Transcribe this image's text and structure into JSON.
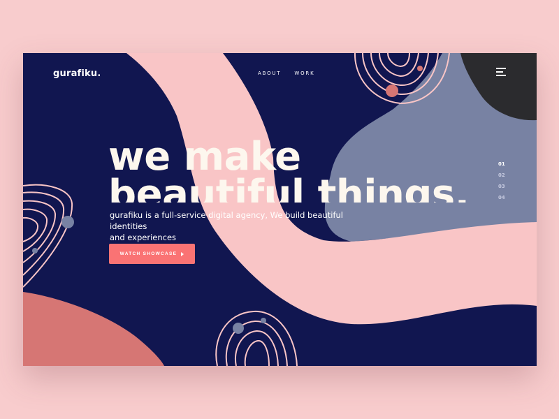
{
  "colors": {
    "page_background": "#f8cccd",
    "navy": "#111650",
    "pink": "#f9c5c6",
    "slate": "#7882a3",
    "coral": "#d67674",
    "dark": "#2b2b2e",
    "cta": "#fa7374",
    "headline": "#fdf7ee"
  },
  "header": {
    "logo": "gurafiku.",
    "nav": [
      "ABOUT",
      "WORK"
    ],
    "menu_icon": "hamburger-menu-icon"
  },
  "hero": {
    "headline_line1": "we make",
    "headline_line2": "beautiful things.",
    "subtitle_line1": "gurafiku is a full-service digital agency, We build beautiful identities",
    "subtitle_line2": "and experiences",
    "cta_label": "WATCH SHOWCASE",
    "cta_icon": "play-arrow-icon"
  },
  "slides": {
    "items": [
      "01",
      "02",
      "03",
      "04"
    ],
    "active": "01"
  }
}
